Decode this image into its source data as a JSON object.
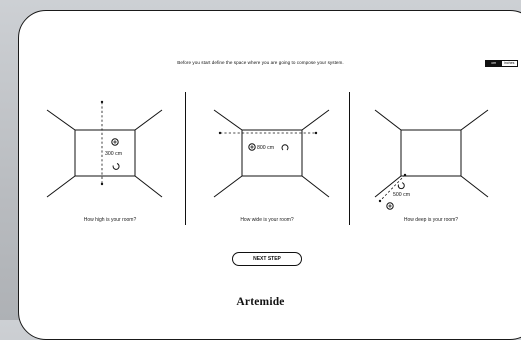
{
  "prompt": "Before you start define the space where you are going to compose your system.",
  "units": {
    "active": "cm",
    "inactive": "inches"
  },
  "panels": [
    {
      "value": "300 cm",
      "caption": "How high is your room?"
    },
    {
      "value": "800 cm",
      "caption": "How wide is your room?"
    },
    {
      "value": "500 cm",
      "caption": "How deep is your room?"
    }
  ],
  "next_button": "NEXT STEP",
  "brand": "Artemide"
}
